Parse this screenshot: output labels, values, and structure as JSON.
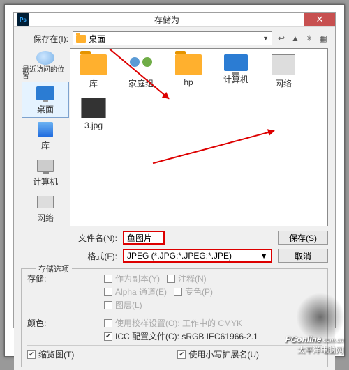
{
  "window": {
    "app_badge": "Ps",
    "title": "存储为",
    "close_glyph": "✕"
  },
  "save_in": {
    "label": "保存在(I):",
    "value": "桌面"
  },
  "places": [
    {
      "label": "最近访问的位置",
      "icon": "recent"
    },
    {
      "label": "桌面",
      "icon": "desktop",
      "selected": true
    },
    {
      "label": "库",
      "icon": "library"
    },
    {
      "label": "计算机",
      "icon": "computer"
    },
    {
      "label": "网络",
      "icon": "network"
    }
  ],
  "files": [
    {
      "label": "库",
      "icon": "folder"
    },
    {
      "label": "家庭组",
      "icon": "homegroup"
    },
    {
      "label": "hp",
      "icon": "folder"
    },
    {
      "label": "计算机",
      "icon": "monitor"
    },
    {
      "label": "网络",
      "icon": "net"
    },
    {
      "label": "3.jpg",
      "icon": "thumb"
    }
  ],
  "filename": {
    "label": "文件名(N):",
    "value": "鱼图片"
  },
  "format": {
    "label": "格式(F):",
    "value": "JPEG (*.JPG;*.JPEG;*.JPE)"
  },
  "buttons": {
    "save": "保存(S)",
    "cancel": "取消"
  },
  "options": {
    "group_title": "存储选项",
    "save_label": "存储:",
    "as_copy": "作为副本(Y)",
    "annotations": "注释(N)",
    "alpha": "Alpha 通道(E)",
    "spot": "专色(P)",
    "layers": "图层(L)",
    "color_label": "颜色:",
    "use_proof": "使用校样设置(O): 工作中的 CMYK",
    "icc_profile": "ICC 配置文件(C): sRGB IEC61966-2.1",
    "thumbnail": "缩览图(T)",
    "lowercase_ext": "使用小写扩展名(U)"
  },
  "watermark": {
    "brand": "PConline",
    "suffix": ".com.cn",
    "tagline": "太平洋电脑网"
  }
}
